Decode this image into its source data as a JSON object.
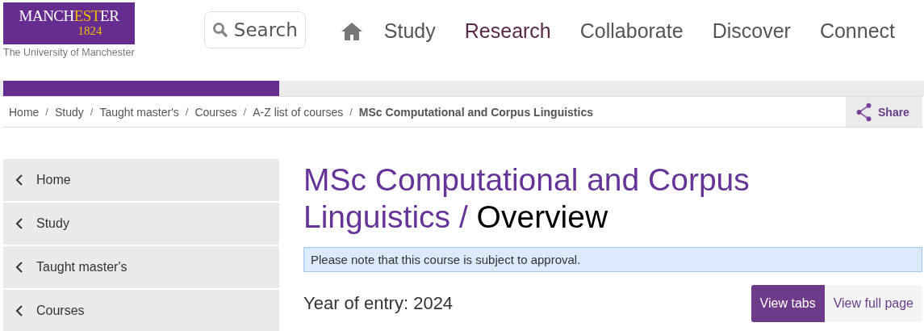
{
  "logo": {
    "wordmark_parts": [
      {
        "text": "MANCH",
        "highlight": false
      },
      {
        "text": "EST",
        "highlight": true
      },
      {
        "text": "ER",
        "highlight": false
      }
    ],
    "year": "1824",
    "tagline": "The University of Manchester"
  },
  "search": {
    "placeholder": "Search"
  },
  "nav": [
    {
      "kind": "home",
      "active": false
    },
    {
      "kind": "link",
      "label": "Study",
      "active": false
    },
    {
      "kind": "link",
      "label": "Research",
      "active": true
    },
    {
      "kind": "link",
      "label": "Collaborate",
      "active": false
    },
    {
      "kind": "link",
      "label": "Discover",
      "active": false
    },
    {
      "kind": "link",
      "label": "Connect",
      "active": false
    }
  ],
  "progress": {
    "level": 0.3
  },
  "breadcrumb": [
    {
      "label": "Home",
      "current": false
    },
    {
      "label": "Study",
      "current": false
    },
    {
      "label": "Taught master's",
      "current": false
    },
    {
      "label": "Courses",
      "current": false
    },
    {
      "label": "A-Z list of courses",
      "current": false
    },
    {
      "label": "MSc Computational and Corpus Linguistics",
      "current": true
    }
  ],
  "separator": "/",
  "share": {
    "label": "Share"
  },
  "sidebar": {
    "items": [
      "Home",
      "Study",
      "Taught master's",
      "Courses"
    ]
  },
  "page_title": {
    "course": "MSc Computational and Corpus Linguistics /",
    "section": "Overview"
  },
  "notice": "Please note that this course is subject to approval.",
  "year_of_entry": "Year of entry: 2024",
  "view_toggle": [
    {
      "label": "View tabs",
      "selected": true
    },
    {
      "label": "View full page",
      "selected": false
    }
  ]
}
